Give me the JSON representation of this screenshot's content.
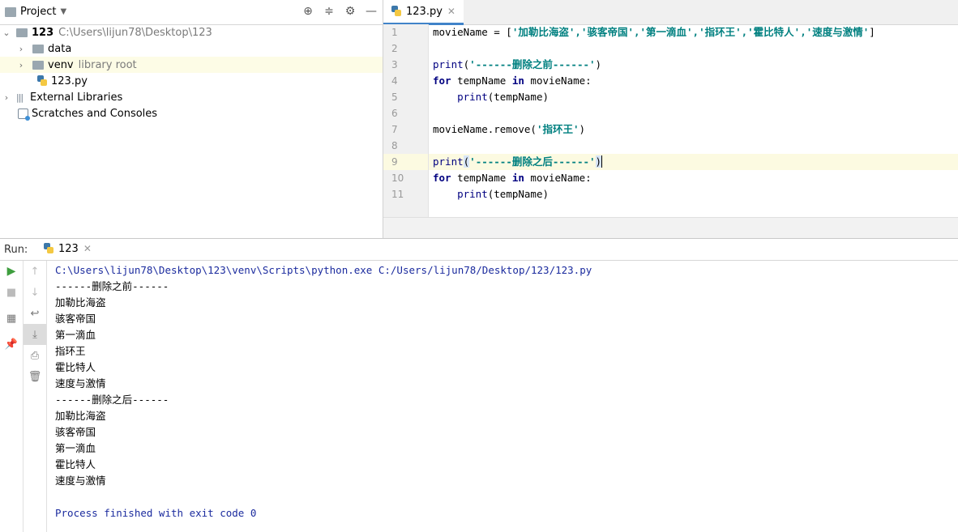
{
  "project": {
    "title": "Project",
    "tree": [
      {
        "name": "123",
        "path": "C:\\Users\\lijun78\\Desktop\\123"
      },
      {
        "name": "data"
      },
      {
        "name": "venv",
        "note": "library root"
      },
      {
        "name": "123.py"
      },
      {
        "name": "External Libraries"
      },
      {
        "name": "Scratches and Consoles"
      }
    ]
  },
  "editor": {
    "tab_label": "123.py",
    "line_numbers": [
      "1",
      "2",
      "3",
      "4",
      "5",
      "6",
      "7",
      "8",
      "9",
      "10",
      "11"
    ],
    "code": {
      "l1_a": "movieName = [",
      "l1_s": "'加勒比海盗','骇客帝国','第一滴血','指环王','霍比特人','速度与激情'",
      "l1_b": "]",
      "l3_fn": "print",
      "l3_s": "'------删除之前------'",
      "l4_kw1": "for",
      "l4_a": " tempName ",
      "l4_kw2": "in",
      "l4_b": " movieName:",
      "l5_fn": "print",
      "l5_a": "(tempName)",
      "l7_a": "movieName.remove(",
      "l7_s": "'指环王'",
      "l7_b": ")",
      "l9_fn": "print",
      "l9_s": "'------删除之后------'",
      "l10_kw1": "for",
      "l10_a": " tempName ",
      "l10_kw2": "in",
      "l10_b": " movieName:",
      "l11_fn": "print",
      "l11_a": "(tempName)"
    }
  },
  "run": {
    "label": "Run:",
    "tab_label": "123",
    "output": [
      "C:\\Users\\lijun78\\Desktop\\123\\venv\\Scripts\\python.exe C:/Users/lijun78/Desktop/123/123.py",
      "------删除之前------",
      "加勒比海盗",
      "骇客帝国",
      "第一滴血",
      "指环王",
      "霍比特人",
      "速度与激情",
      "------删除之后------",
      "加勒比海盗",
      "骇客帝国",
      "第一滴血",
      "霍比特人",
      "速度与激情",
      "",
      "Process finished with exit code 0"
    ]
  },
  "colors": {
    "accent": "#4083c9",
    "keyword": "#000080",
    "string": "#008080",
    "console_blue": "#1b2b9e"
  }
}
